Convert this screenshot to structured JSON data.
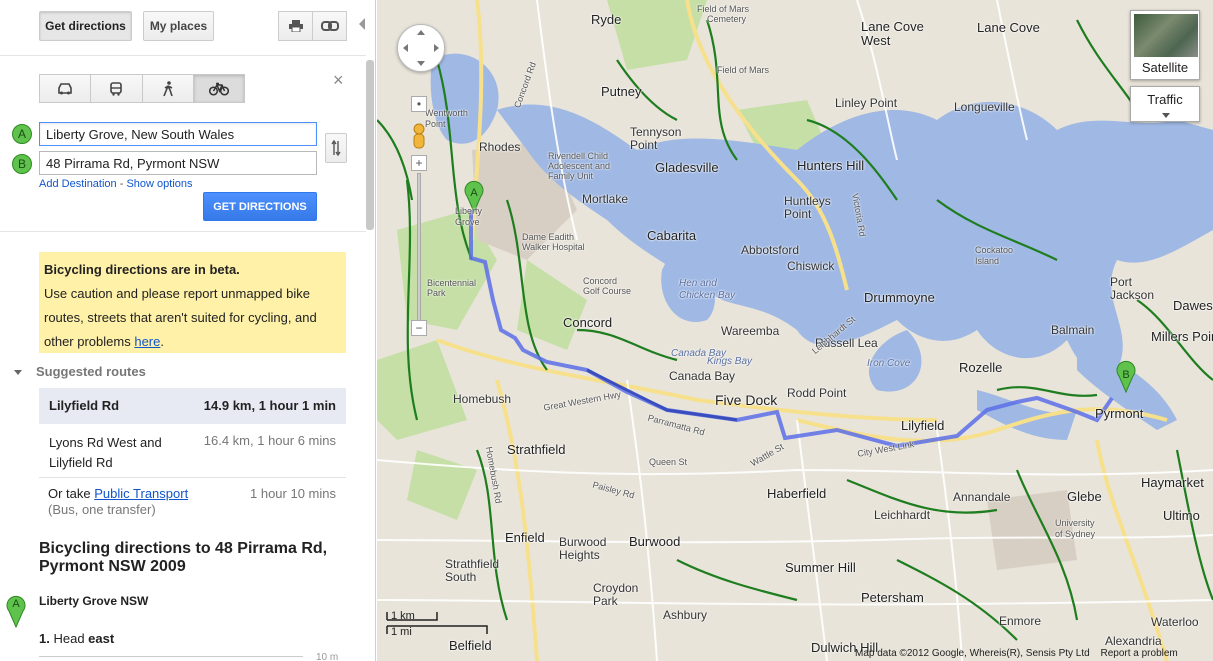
{
  "topbar": {
    "get_directions": "Get directions",
    "my_places": "My places",
    "print_icon": "print-icon",
    "link_icon": "link-icon"
  },
  "modes": [
    "car-icon",
    "transit-icon",
    "walk-icon",
    "bicycle-icon"
  ],
  "form": {
    "marker_a": "A",
    "marker_b": "B",
    "origin": "Liberty Grove, New South Wales",
    "destination": "48 Pirrama Rd, Pyrmont NSW",
    "add_destination": "Add Destination",
    "dash": "-",
    "show_options": "Show options",
    "get_directions_btn": "GET DIRECTIONS"
  },
  "beta": {
    "title": "Bicycling directions are in beta.",
    "line1": "Use caution and please report unmapped bike",
    "line2": "routes, streets that aren't suited for cycling, and",
    "line3_prefix": "other problems",
    "line3_link": "here",
    "line3_suffix": "."
  },
  "suggested": {
    "label": "Suggested routes",
    "routes": [
      {
        "name": "Lilyfield Rd",
        "detail": "14.9 km, 1 hour 1 min"
      },
      {
        "name_line1": "Lyons Rd West and",
        "name_line2": "Lilyfield Rd",
        "detail": "16.4 km, 1 hour 6 mins"
      }
    ],
    "transit_prefix": "Or take",
    "transit_link": "Public Transport",
    "transit_note": "(Bus, one transfer)",
    "transit_time": "1 hour 10 mins"
  },
  "directions": {
    "title_line1": "Bicycling directions to 48 Pirrama Rd,",
    "title_line2": "Pyrmont NSW 2009",
    "start_marker": "A",
    "start": "Liberty Grove NSW",
    "step_number": "1.",
    "step_text": "Head",
    "step_bold": "east",
    "step_distance": "10 m"
  },
  "map": {
    "satellite": "Satellite",
    "traffic": "Traffic",
    "scale_km": "1 km",
    "scale_mi": "1 mi",
    "footer_data": "Map data ©2012 Google, Whereis(R), Sensis Pty Ltd",
    "footer_report": "Report a problem",
    "marker_a": "A",
    "marker_b": "B",
    "labels": {
      "ryde": "Ryde",
      "field_of_mars": "Field of Mars",
      "cemetery": "Cemetery",
      "lane_cove_west": "Lane Cove\nWest",
      "lane_cove": "Lane Cove",
      "putney": "Putney",
      "tennyson_point": "Tennyson\nPoint",
      "gladesville": "Gladesville",
      "linley_point": "Linley Point",
      "longueville": "Longueville",
      "hunters_hill": "Hunters Hill",
      "huntleys_point": "Huntleys\nPoint",
      "rhodes": "Rhodes",
      "liberty_grove": "Liberty\nGrove",
      "wentworth_point": "Wentworth\nPoint",
      "mortlake": "Mortlake",
      "cabarita": "Cabarita",
      "abbotsford": "Abbotsford",
      "chiswick": "Chiswick",
      "drummoyne": "Drummoyne",
      "cockatoo_island": "Cockatoo\nIsland",
      "port_jackson": "Port\nJackson",
      "dawes": "Dawes",
      "balmain": "Balmain",
      "millers_point": "Millers Point",
      "concord": "Concord",
      "wareemba": "Wareemba",
      "russell_lea": "Russell Lea",
      "rozelle": "Rozelle",
      "canada_bay": "Canada Bay",
      "homebush": "Homebush",
      "five_dock": "Five Dock",
      "rodd_point": "Rodd Point",
      "lilyfield": "Lilyfield",
      "pyrmont": "Pyrmont",
      "strathfield": "Strathfield",
      "haberfield": "Haberfield",
      "annandale": "Annandale",
      "glebe": "Glebe",
      "haymarket": "Haymarket",
      "ultimo": "Ultimo",
      "leichhardt": "Leichhardt",
      "enfield": "Enfield",
      "burwood_heights": "Burwood\nHeights",
      "burwood": "Burwood",
      "strathfield_south": "Strathfield\nSouth",
      "croydon_park": "Croydon\nPark",
      "summer_hill": "Summer Hill",
      "petersham": "Petersham",
      "enmore": "Enmore",
      "waterloo": "Waterloo",
      "alexandria": "Alexandria",
      "ashbury": "Ashbury",
      "belfield": "Belfield",
      "dulwich_hill": "Dulwich Hill",
      "university_of_sydney": "University\nof Sydney",
      "hen_and_chicken_bay": "Hen and\nChicken Bay",
      "iron_cove": "Iron Cove",
      "dame_eadith": "Dame Eadith\nWalker Hospital",
      "rivendell": "Rivendell Child\nAdolescent and\nFamily Unit",
      "bicentennial_park": "Bicentennial\nPark",
      "concord_golf": "Concord\nGolf Course",
      "canada_bay_water": "Canada Bay",
      "kings_bay": "Kings Bay",
      "victoria_rd": "Victoria Rd",
      "parramatta_rd": "Parramatta Rd",
      "great_western_hwy": "Great Western Hwy",
      "city_west_link": "City West Link",
      "queen_st": "Queen St",
      "wattle_st": "Wattle St",
      "paisley_rd": "Paisley Rd",
      "concord_rd": "Concord Rd",
      "homebush_rd": "Homebush Rd",
      "leichhardt_st": "Leichhardt St"
    }
  }
}
